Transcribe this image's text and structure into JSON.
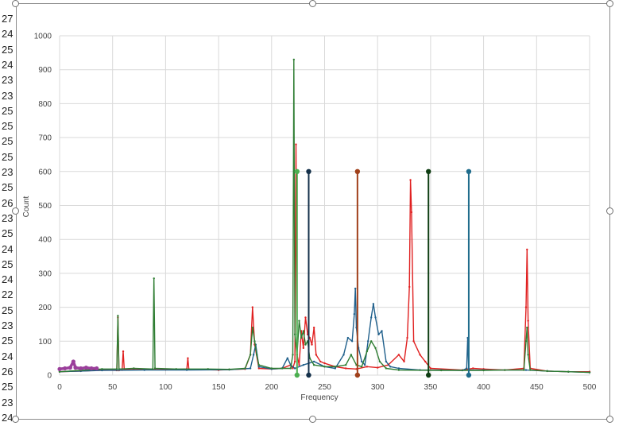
{
  "sheet": {
    "row_labels": [
      "27",
      "24",
      "25",
      "24",
      "23",
      "23",
      "25",
      "25",
      "25",
      "25",
      "23",
      "25",
      "26",
      "23",
      "25",
      "24",
      "25",
      "24",
      "22",
      "25",
      "23",
      "25",
      "24",
      "26",
      "25",
      "23",
      "24"
    ]
  },
  "chart_data": {
    "type": "line",
    "xlabel": "Frequency",
    "ylabel": "Count",
    "xlim": [
      0,
      500
    ],
    "ylim": [
      0,
      1000
    ],
    "x_ticks": [
      "0",
      "50",
      "100",
      "150",
      "200",
      "250",
      "300",
      "350",
      "400",
      "450",
      "500"
    ],
    "y_ticks": [
      "0",
      "100",
      "200",
      "300",
      "400",
      "500",
      "600",
      "700",
      "800",
      "900",
      "1000"
    ],
    "grid": true,
    "legend": "none",
    "colors": {
      "red": "#e02020",
      "blue": "#1f5f8b",
      "green": "#2e7d32",
      "purple": "#9b3f9b",
      "light_green": "#4caf50",
      "dark_navy": "#14304a",
      "brown": "#a0401a",
      "dark_green": "#0e3d12",
      "teal": "#1f6c8c"
    },
    "series": [
      {
        "color_key": "red",
        "points": [
          [
            0,
            10
          ],
          [
            20,
            12
          ],
          [
            40,
            15
          ],
          [
            54,
            14
          ],
          [
            55,
            170
          ],
          [
            56,
            14
          ],
          [
            59,
            15
          ],
          [
            60,
            70
          ],
          [
            61,
            16
          ],
          [
            80,
            17
          ],
          [
            100,
            16
          ],
          [
            120,
            18
          ],
          [
            121,
            50
          ],
          [
            122,
            17
          ],
          [
            150,
            15
          ],
          [
            175,
            18
          ],
          [
            180,
            60
          ],
          [
            182,
            200
          ],
          [
            184,
            90
          ],
          [
            188,
            20
          ],
          [
            200,
            18
          ],
          [
            210,
            20
          ],
          [
            218,
            30
          ],
          [
            220,
            20
          ],
          [
            222,
            40
          ],
          [
            223,
            680
          ],
          [
            224,
            60
          ],
          [
            226,
            30
          ],
          [
            228,
            130
          ],
          [
            230,
            80
          ],
          [
            232,
            170
          ],
          [
            234,
            120
          ],
          [
            236,
            110
          ],
          [
            238,
            90
          ],
          [
            240,
            140
          ],
          [
            242,
            60
          ],
          [
            246,
            40
          ],
          [
            250,
            35
          ],
          [
            260,
            25
          ],
          [
            270,
            20
          ],
          [
            280,
            18
          ],
          [
            290,
            25
          ],
          [
            300,
            22
          ],
          [
            310,
            30
          ],
          [
            320,
            60
          ],
          [
            325,
            40
          ],
          [
            328,
            110
          ],
          [
            330,
            260
          ],
          [
            331,
            575
          ],
          [
            332,
            480
          ],
          [
            334,
            100
          ],
          [
            340,
            60
          ],
          [
            345,
            40
          ],
          [
            350,
            20
          ],
          [
            380,
            15
          ],
          [
            390,
            20
          ],
          [
            400,
            18
          ],
          [
            420,
            15
          ],
          [
            438,
            20
          ],
          [
            440,
            200
          ],
          [
            441,
            370
          ],
          [
            442,
            160
          ],
          [
            444,
            20
          ],
          [
            460,
            12
          ],
          [
            480,
            10
          ],
          [
            500,
            10
          ]
        ]
      },
      {
        "color_key": "blue",
        "points": [
          [
            0,
            10
          ],
          [
            20,
            12
          ],
          [
            40,
            14
          ],
          [
            80,
            15
          ],
          [
            120,
            15
          ],
          [
            160,
            16
          ],
          [
            180,
            20
          ],
          [
            183,
            60
          ],
          [
            185,
            90
          ],
          [
            188,
            25
          ],
          [
            200,
            18
          ],
          [
            210,
            20
          ],
          [
            215,
            50
          ],
          [
            218,
            30
          ],
          [
            222,
            20
          ],
          [
            230,
            30
          ],
          [
            240,
            40
          ],
          [
            250,
            25
          ],
          [
            260,
            20
          ],
          [
            268,
            60
          ],
          [
            272,
            110
          ],
          [
            276,
            100
          ],
          [
            278,
            180
          ],
          [
            279,
            255
          ],
          [
            280,
            140
          ],
          [
            282,
            80
          ],
          [
            285,
            40
          ],
          [
            288,
            30
          ],
          [
            291,
            100
          ],
          [
            294,
            170
          ],
          [
            296,
            210
          ],
          [
            298,
            170
          ],
          [
            301,
            120
          ],
          [
            304,
            130
          ],
          [
            308,
            40
          ],
          [
            312,
            25
          ],
          [
            320,
            20
          ],
          [
            340,
            15
          ],
          [
            360,
            15
          ],
          [
            380,
            14
          ],
          [
            384,
            20
          ],
          [
            385,
            110
          ],
          [
            386,
            15
          ],
          [
            400,
            15
          ],
          [
            440,
            15
          ],
          [
            460,
            12
          ],
          [
            480,
            10
          ],
          [
            500,
            8
          ]
        ]
      },
      {
        "color_key": "green",
        "points": [
          [
            0,
            10
          ],
          [
            20,
            14
          ],
          [
            40,
            18
          ],
          [
            54,
            18
          ],
          [
            55,
            175
          ],
          [
            56,
            18
          ],
          [
            70,
            20
          ],
          [
            88,
            18
          ],
          [
            89,
            285
          ],
          [
            90,
            20
          ],
          [
            110,
            18
          ],
          [
            140,
            18
          ],
          [
            160,
            17
          ],
          [
            175,
            20
          ],
          [
            180,
            60
          ],
          [
            182,
            140
          ],
          [
            184,
            100
          ],
          [
            186,
            60
          ],
          [
            188,
            30
          ],
          [
            200,
            20
          ],
          [
            210,
            20
          ],
          [
            218,
            20
          ],
          [
            220,
            60
          ],
          [
            221,
            930
          ],
          [
            222,
            120
          ],
          [
            224,
            60
          ],
          [
            226,
            160
          ],
          [
            228,
            110
          ],
          [
            230,
            130
          ],
          [
            232,
            90
          ],
          [
            234,
            100
          ],
          [
            236,
            50
          ],
          [
            240,
            30
          ],
          [
            250,
            25
          ],
          [
            260,
            25
          ],
          [
            270,
            30
          ],
          [
            275,
            60
          ],
          [
            280,
            30
          ],
          [
            285,
            25
          ],
          [
            290,
            70
          ],
          [
            294,
            100
          ],
          [
            298,
            80
          ],
          [
            302,
            40
          ],
          [
            308,
            20
          ],
          [
            320,
            15
          ],
          [
            360,
            14
          ],
          [
            400,
            14
          ],
          [
            420,
            15
          ],
          [
            438,
            15
          ],
          [
            440,
            100
          ],
          [
            441,
            140
          ],
          [
            442,
            60
          ],
          [
            444,
            15
          ],
          [
            460,
            12
          ],
          [
            480,
            10
          ],
          [
            500,
            8
          ]
        ]
      },
      {
        "color_key": "purple",
        "points": [
          [
            0,
            18
          ],
          [
            5,
            20
          ],
          [
            10,
            22
          ],
          [
            13,
            40
          ],
          [
            15,
            22
          ],
          [
            20,
            20
          ],
          [
            25,
            22
          ],
          [
            30,
            20
          ],
          [
            35,
            20
          ]
        ]
      }
    ],
    "markers": [
      {
        "color_key": "light_green",
        "x": 224,
        "y": 600
      },
      {
        "color_key": "dark_navy",
        "x": 235,
        "y": 600
      },
      {
        "color_key": "brown",
        "x": 281,
        "y": 600
      },
      {
        "color_key": "dark_green",
        "x": 348,
        "y": 600
      },
      {
        "color_key": "teal",
        "x": 386,
        "y": 600
      }
    ]
  }
}
